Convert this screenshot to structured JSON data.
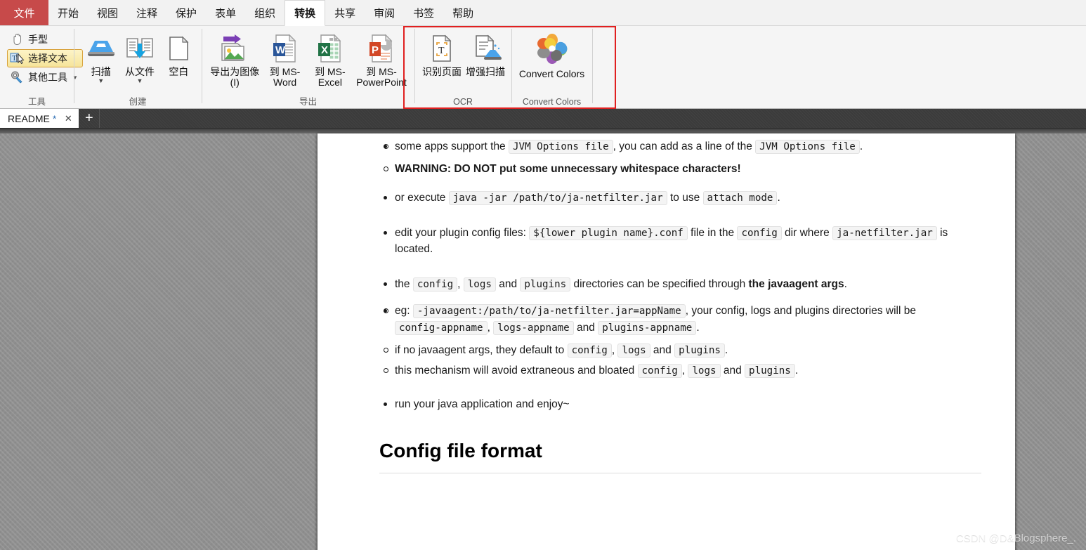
{
  "menubar": {
    "file_label": "文件",
    "items": [
      {
        "label": "开始",
        "active": false
      },
      {
        "label": "视图",
        "active": false
      },
      {
        "label": "注释",
        "active": false
      },
      {
        "label": "保护",
        "active": false
      },
      {
        "label": "表单",
        "active": false
      },
      {
        "label": "组织",
        "active": false
      },
      {
        "label": "转换",
        "active": true
      },
      {
        "label": "共享",
        "active": false
      },
      {
        "label": "审阅",
        "active": false
      },
      {
        "label": "书签",
        "active": false
      },
      {
        "label": "帮助",
        "active": false
      }
    ]
  },
  "ribbon": {
    "highlight_color": "#e02020",
    "groups": {
      "tools": {
        "title": "工具",
        "items": [
          {
            "label": "手型",
            "icon": "hand-icon",
            "selected": false,
            "has_caret": false
          },
          {
            "label": "选择文本",
            "icon": "select-text-icon",
            "selected": true,
            "has_caret": false
          },
          {
            "label": "其他工具",
            "icon": "other-tools-icon",
            "selected": false,
            "has_caret": true
          }
        ]
      },
      "create": {
        "title": "创建",
        "items": [
          {
            "label": "扫描",
            "icon": "scanner-icon",
            "has_dropdown": true
          },
          {
            "label": "从文件",
            "icon": "from-file-icon",
            "has_dropdown": true
          },
          {
            "label": "空白",
            "icon": "blank-page-icon",
            "has_dropdown": false
          }
        ]
      },
      "export": {
        "title": "导出",
        "items": [
          {
            "label": "导出为图像(I)",
            "icon": "export-image-icon"
          },
          {
            "label": "到 MS-Word",
            "icon": "ms-word-icon"
          },
          {
            "label": "到 MS-Excel",
            "icon": "ms-excel-icon"
          },
          {
            "label": "到 MS-PowerPoint",
            "icon": "ms-powerpoint-icon"
          }
        ]
      },
      "ocr": {
        "title": "OCR",
        "items": [
          {
            "label": "识别页面",
            "icon": "ocr-recognize-icon"
          },
          {
            "label": "增强扫描",
            "icon": "enhance-scan-icon"
          }
        ]
      },
      "convert_colors": {
        "title": "Convert Colors",
        "items": [
          {
            "label": "Convert Colors",
            "icon": "color-wheel-icon"
          }
        ]
      }
    }
  },
  "tabstrip": {
    "tabs": [
      {
        "title": "README",
        "modified_marker": "*",
        "close_glyph": "✕"
      }
    ],
    "new_tab_glyph": "+"
  },
  "document": {
    "blocks": [
      {
        "type": "sub-bullet",
        "parts": [
          {
            "t": "text",
            "v": "some apps support the "
          },
          {
            "t": "code",
            "v": "JVM Options file"
          },
          {
            "t": "text",
            "v": ", you can add as a line of the "
          },
          {
            "t": "code",
            "v": "JVM Options file"
          },
          {
            "t": "text",
            "v": "."
          }
        ]
      },
      {
        "type": "sub-bullet",
        "parts": [
          {
            "t": "bold",
            "v": "WARNING: DO NOT put some unnecessary whitespace characters!"
          }
        ]
      },
      {
        "type": "bullet",
        "parts": [
          {
            "t": "text",
            "v": "or execute "
          },
          {
            "t": "code",
            "v": "java -jar /path/to/ja-netfilter.jar"
          },
          {
            "t": "text",
            "v": " to use "
          },
          {
            "t": "code",
            "v": "attach mode"
          },
          {
            "t": "text",
            "v": "."
          }
        ]
      },
      {
        "type": "bullet",
        "parts": [
          {
            "t": "text",
            "v": "edit your plugin config files: "
          },
          {
            "t": "code",
            "v": "${lower plugin name}.conf"
          },
          {
            "t": "text",
            "v": " file in the "
          },
          {
            "t": "code",
            "v": "config"
          },
          {
            "t": "text",
            "v": " dir where "
          },
          {
            "t": "code",
            "v": "ja-netfilter.jar"
          },
          {
            "t": "text",
            "v": " is located."
          }
        ]
      },
      {
        "type": "bullet",
        "parts": [
          {
            "t": "text",
            "v": "the "
          },
          {
            "t": "code",
            "v": "config"
          },
          {
            "t": "text",
            "v": ", "
          },
          {
            "t": "code",
            "v": "logs"
          },
          {
            "t": "text",
            "v": " and "
          },
          {
            "t": "code",
            "v": "plugins"
          },
          {
            "t": "text",
            "v": " directories can be specified through "
          },
          {
            "t": "bold",
            "v": "the javaagent args"
          },
          {
            "t": "text",
            "v": "."
          }
        ]
      },
      {
        "type": "sub-bullet",
        "parts": [
          {
            "t": "text",
            "v": "eg: "
          },
          {
            "t": "code",
            "v": "-javaagent:/path/to/ja-netfilter.jar=appName"
          },
          {
            "t": "text",
            "v": ", your config, logs and plugins directories will be "
          },
          {
            "t": "code",
            "v": "config-appname"
          },
          {
            "t": "text",
            "v": ", "
          },
          {
            "t": "code",
            "v": "logs-appname"
          },
          {
            "t": "text",
            "v": " and "
          },
          {
            "t": "code",
            "v": "plugins-appname"
          },
          {
            "t": "text",
            "v": "."
          }
        ]
      },
      {
        "type": "sub-bullet",
        "parts": [
          {
            "t": "text",
            "v": "if no javaagent args, they default to "
          },
          {
            "t": "code",
            "v": "config"
          },
          {
            "t": "text",
            "v": ", "
          },
          {
            "t": "code",
            "v": "logs"
          },
          {
            "t": "text",
            "v": " and "
          },
          {
            "t": "code",
            "v": "plugins"
          },
          {
            "t": "text",
            "v": "."
          }
        ]
      },
      {
        "type": "sub-bullet",
        "parts": [
          {
            "t": "text",
            "v": "this mechanism will avoid extraneous and bloated "
          },
          {
            "t": "code",
            "v": "config"
          },
          {
            "t": "text",
            "v": ", "
          },
          {
            "t": "code",
            "v": "logs"
          },
          {
            "t": "text",
            "v": " and "
          },
          {
            "t": "code",
            "v": "plugins"
          },
          {
            "t": "text",
            "v": "."
          }
        ]
      },
      {
        "type": "bullet",
        "parts": [
          {
            "t": "text",
            "v": "run your java application and enjoy~"
          }
        ]
      }
    ],
    "heading": "Config file format"
  },
  "watermark": "CSDN @D&Blogsphere_."
}
